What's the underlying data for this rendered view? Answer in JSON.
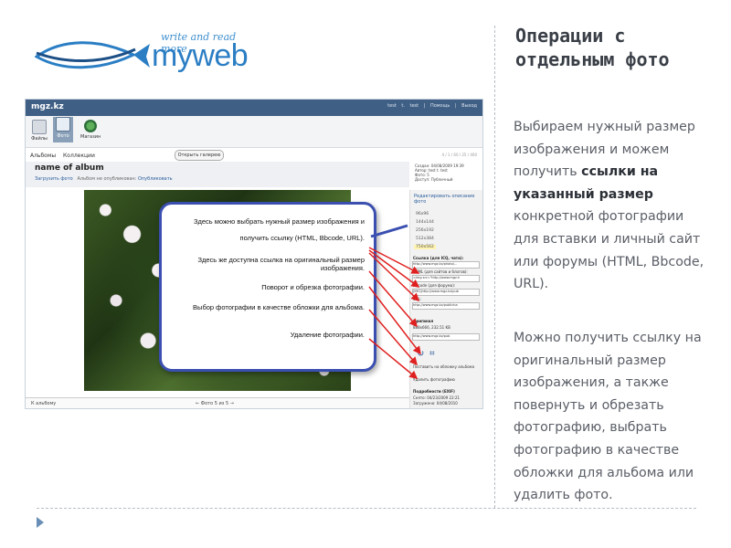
{
  "logo": {
    "tagline": "write and read more",
    "name": "myweb"
  },
  "screenshot": {
    "site": "mgz.kz",
    "top_links": "test t. test | Помощь | Выход",
    "toolbar": [
      "Файлы",
      "Фото",
      "Магазин"
    ],
    "nav": [
      "Альбомы",
      "Коллекции"
    ],
    "gallery_button": "Открыть галерею",
    "stats": "4 / 1 / 60 / 25 / 400",
    "album_title": "name of album",
    "upload_link": "Загрузить фото",
    "album_status": "Альбом не опубликован:",
    "publish_link": "Опубликовать",
    "meta": "Создан: 04/08/2009 19:39\nАвтор: test t. test\nФото: 5\nДоступ: Публичный",
    "side": {
      "edit_link": "Редактировать описание фото",
      "sizes": [
        "96x96",
        "144x144",
        "256x192",
        "512x384",
        "750x562"
      ],
      "selected_size": "750x562",
      "link_label": "Ссылка (для ICQ, чата):",
      "link_value": "http://www.mgz.kz/photo/...",
      "html_label": "HTML (для сайтов и блогов):",
      "html_value": "<img src=\"http://www.mgz.k",
      "bbcode_label": "BBcode (для форума):",
      "bbcode_value": "[IMG]http://www.mgz.kz/pub",
      "url_label": "URL:",
      "url_value": "http://www.mgz.kz/publicha",
      "original_label": "Оригинал",
      "original_info": "888x666, 232.51 KB",
      "original_value": "http://www.mgz.kz/pub",
      "cover_action": "Поставить на обложку альбома",
      "delete_action": "Удалить фотографию",
      "exif_label": "Подробности (EXIF)",
      "exif_taken": "Снято: 04/23/2009 22:21",
      "exif_uploaded": "Загружено: 04/08/2010"
    },
    "footer_back": "К альбому",
    "footer_pager": "← Фото 5 из 5 →",
    "callout": {
      "line1": "Здесь можно выбрать нужный размер изображения и",
      "line2": "получить ссылку (HTML, Bbcode, URL).",
      "line3": "Здесь же доступна ссылка на оригинальный размер изображения.",
      "line4": "Поворот и обрезка фотографии.",
      "line5": "Выбор фотографии в качестве обложки для альбома.",
      "line6": "Удаление фотографии."
    }
  },
  "title": "Операции с отдельным фото",
  "paragraph1_start": "Выбираем нужный размер изображения и можем получить ",
  "paragraph1_bold": "ссылки на указанный размер",
  "paragraph1_end": " конкретной фотографии для вставки и личный сайт или форумы (HTML, Bbcode, URL).",
  "paragraph2": "Можно получить ссылку на оригинальный размер изображения, а также повернуть и обрезать фотографию, выбрать фотографию в качестве обложки для альбома или удалить фото.",
  "colors": {
    "accent": "#2b7ec4",
    "callout_border": "#3a4fb0",
    "arrow": "#e02020",
    "topbar": "#3f5f85"
  }
}
